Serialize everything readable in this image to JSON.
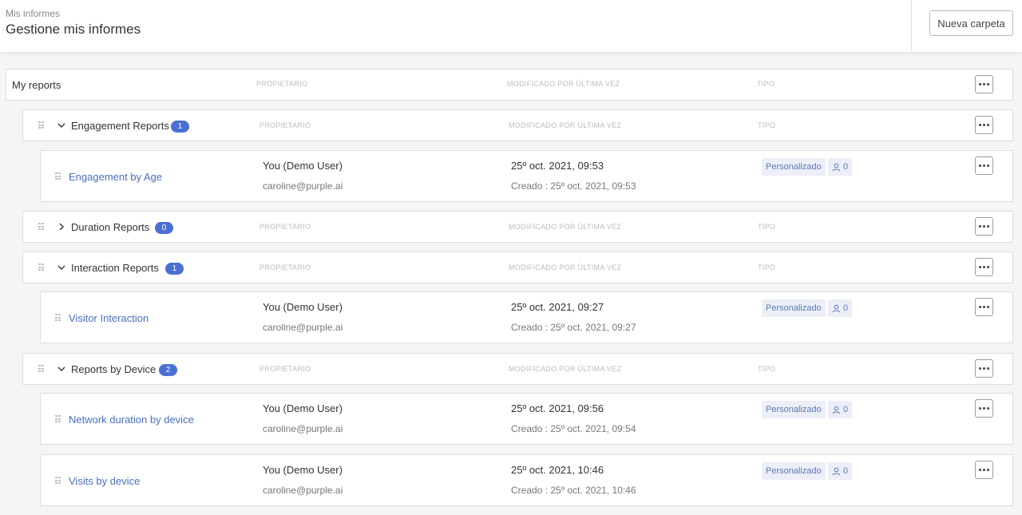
{
  "header": {
    "breadcrumb": "Mis informes",
    "title": "Gestione mis informes",
    "new_folder_label": "Nueva carpeta"
  },
  "columns": {
    "owner": "PROPIETARIO",
    "modified": "MODIFICADO POR ÚLTIMA VEZ",
    "type": "TIPO"
  },
  "root": {
    "name": "My reports"
  },
  "folders": [
    {
      "name": "Engagement Reports",
      "count": "1",
      "expanded": true,
      "reports": [
        {
          "name": "Engagement by Age",
          "owner": "You (Demo User)",
          "email": "caroline@purple.ai",
          "modified": "25º oct. 2021, 09:53",
          "created": "Creado : 25º oct. 2021, 09:53",
          "type": "Personalizado",
          "shares": "0"
        }
      ]
    },
    {
      "name": "Duration Reports",
      "count": "0",
      "expanded": false,
      "reports": []
    },
    {
      "name": "Interaction Reports",
      "count": "1",
      "expanded": true,
      "reports": [
        {
          "name": "Visitor Interaction",
          "owner": "You (Demo User)",
          "email": "caroline@purple.ai",
          "modified": "25º oct. 2021, 09:27",
          "created": "Creado : 25º oct. 2021, 09:27",
          "type": "Personalizado",
          "shares": "0"
        }
      ]
    },
    {
      "name": "Reports by Device",
      "count": "2",
      "expanded": true,
      "reports": [
        {
          "name": "Network duration by device",
          "owner": "You (Demo User)",
          "email": "caroline@purple.ai",
          "modified": "25º oct. 2021, 09:56",
          "created": "Creado : 25º oct. 2021, 09:54",
          "type": "Personalizado",
          "shares": "0"
        },
        {
          "name": "Visits by device",
          "owner": "You (Demo User)",
          "email": "caroline@purple.ai",
          "modified": "25º oct. 2021, 10:46",
          "created": "Creado : 25º oct. 2021, 10:46",
          "type": "Personalizado",
          "shares": "0"
        }
      ]
    }
  ],
  "icons": {
    "more": "more-horizontal-icon",
    "drag": "drag-handle-icon",
    "expand": "chevron-down-icon",
    "collapse": "chevron-right-icon",
    "share": "user-icon"
  },
  "colors": {
    "accent": "#4a6fd3",
    "link": "#4a6fc0",
    "tag_bg": "#eceff7"
  }
}
